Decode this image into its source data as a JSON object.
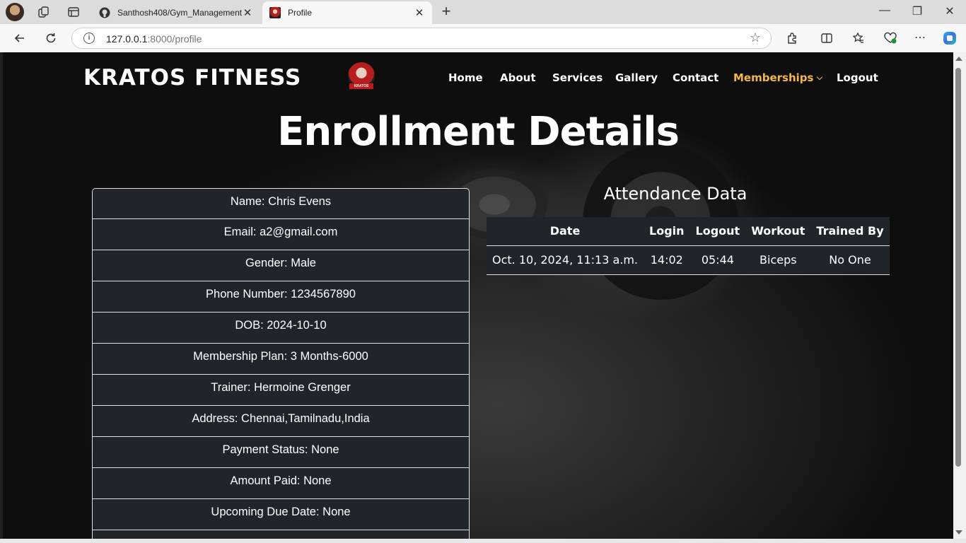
{
  "browser": {
    "tabs": [
      {
        "title": "Santhosh408/Gym_Management_",
        "close": "✕"
      },
      {
        "title": "Profile",
        "close": "✕"
      }
    ],
    "new_tab": "+",
    "url_host": "127.0.0.1",
    "url_rest": ":8000/profile",
    "window_controls": {
      "minimize": "—",
      "maximize": "❐",
      "close": "✕"
    }
  },
  "site": {
    "brand": "KRATOS FITNESS",
    "logo_text": "KRATOS",
    "nav": [
      "Home",
      "About",
      "Services",
      "Gallery",
      "Contact",
      "Memberships",
      "Logout"
    ],
    "active_nav": "Memberships",
    "accent_color": "#f4b945"
  },
  "page": {
    "heading": "Enrollment Details",
    "details": [
      "Name: Chris Evens",
      "Email: a2@gmail.com",
      "Gender: Male",
      "Phone Number: 1234567890",
      "DOB: 2024-10-10",
      "Membership Plan: 3 Months-6000",
      "Trainer: Hermoine Grenger",
      "Address: Chennai,Tamilnadu,India",
      "Payment Status: None",
      "Amount Paid: None",
      "Upcoming Due Date: None"
    ],
    "attendance": {
      "title": "Attendance Data",
      "columns": [
        "Date",
        "Login",
        "Logout",
        "Workout",
        "Trained By"
      ],
      "rows": [
        [
          "Oct. 10, 2024, 11:13 a.m.",
          "14:02",
          "05:44",
          "Biceps",
          "No One"
        ]
      ]
    }
  }
}
